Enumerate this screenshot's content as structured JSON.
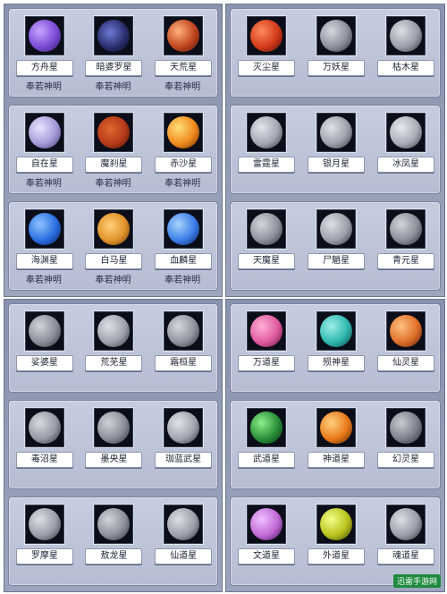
{
  "quadrants": [
    {
      "rows": [
        {
          "cells": [
            {
              "name": "方舟星",
              "owner": "奉若神明",
              "color": "#7a4bd6"
            },
            {
              "name": "暗婆罗星",
              "owner": "奉若神明",
              "color": "#2a2f6e"
            },
            {
              "name": "天荒星",
              "owner": "奉若神明",
              "color": "#c0451f"
            }
          ]
        },
        {
          "cells": [
            {
              "name": "自在星",
              "owner": "奉若神明",
              "color": "#a69bd8"
            },
            {
              "name": "魔刹星",
              "owner": "奉若神明",
              "color": "#b53a1a"
            },
            {
              "name": "赤沙星",
              "owner": "奉若神明",
              "color": "#f08a1c"
            }
          ]
        },
        {
          "cells": [
            {
              "name": "海渊星",
              "owner": "奉若神明",
              "color": "#2a6fe0"
            },
            {
              "name": "白马星",
              "owner": "奉若神明",
              "color": "#e0932a"
            },
            {
              "name": "血麟星",
              "owner": "奉若神明",
              "color": "#3b7de6"
            }
          ]
        }
      ]
    },
    {
      "rows": [
        {
          "cells": [
            {
              "name": "灭尘星",
              "color": "#d23a1a"
            },
            {
              "name": "万妖星",
              "color": "#8b909c"
            },
            {
              "name": "枯木星",
              "color": "#9a9ea8"
            }
          ]
        },
        {
          "cells": [
            {
              "name": "雷霆星",
              "color": "#a3a7b2"
            },
            {
              "name": "银月星",
              "color": "#9da1ab"
            },
            {
              "name": "冰凤星",
              "color": "#a9adb7"
            }
          ]
        },
        {
          "cells": [
            {
              "name": "天魔星",
              "color": "#8e929c"
            },
            {
              "name": "尸魈星",
              "color": "#9ca0aa"
            },
            {
              "name": "青元星",
              "color": "#8b8f99"
            }
          ]
        }
      ]
    },
    {
      "rows": [
        {
          "cells": [
            {
              "name": "娑婆星",
              "color": "#8b8f99"
            },
            {
              "name": "荒芜星",
              "color": "#9ea2ac"
            },
            {
              "name": "霜桓星",
              "color": "#8f939d"
            }
          ]
        },
        {
          "cells": [
            {
              "name": "毒沼星",
              "color": "#959aa4"
            },
            {
              "name": "墨央星",
              "color": "#8a8e98"
            },
            {
              "name": "珈蓝武星",
              "color": "#a0a4ae"
            }
          ]
        },
        {
          "cells": [
            {
              "name": "罗摩星",
              "color": "#9a9ea8"
            },
            {
              "name": "敖龙星",
              "color": "#8c909a"
            },
            {
              "name": "仙道星",
              "color": "#9ca0aa"
            }
          ]
        }
      ]
    },
    {
      "rows": [
        {
          "cells": [
            {
              "name": "万道星",
              "color": "#e05aa0"
            },
            {
              "name": "殒神星",
              "color": "#2fb8b0"
            },
            {
              "name": "仙灵星",
              "color": "#e0702a"
            }
          ]
        },
        {
          "cells": [
            {
              "name": "武道星",
              "color": "#2a8f3a"
            },
            {
              "name": "神道星",
              "color": "#e87a1a"
            },
            {
              "name": "幻灵星",
              "color": "#7d818c"
            }
          ]
        },
        {
          "cells": [
            {
              "name": "文道星",
              "color": "#c06ad6"
            },
            {
              "name": "外道星",
              "color": "#b8c21c"
            },
            {
              "name": "魂道星",
              "color": "#9a9ea8"
            }
          ]
        }
      ]
    }
  ],
  "watermark": "迅雷手游网"
}
